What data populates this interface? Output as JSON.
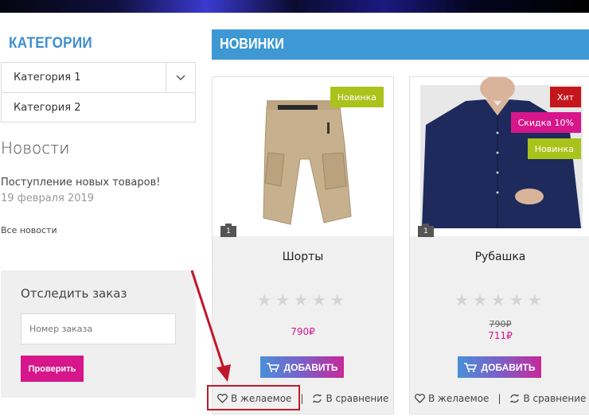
{
  "sidebar": {
    "categories_title": "КАТЕГОРИИ",
    "categories": [
      {
        "label": "Категория 1"
      },
      {
        "label": "Категория 2"
      }
    ],
    "news": {
      "title": "Новости",
      "item_title": "Поступление новых товаров!",
      "item_date": "19 февраля 2019",
      "all_link": "Все новости"
    },
    "track": {
      "title": "Отследить заказ",
      "input_placeholder": "Номер заказа",
      "button_label": "Проверить"
    }
  },
  "main": {
    "section_title": "НОВИНКИ",
    "products": [
      {
        "name": "Шорты",
        "badges": [
          {
            "label": "Новинка",
            "color": "#a9c31b"
          }
        ],
        "image_count": "1",
        "old_price": "",
        "price": "790₽",
        "add_label": "ДОБАВИТЬ",
        "wishlist_label": "В желаемое",
        "compare_label": "В сравнение"
      },
      {
        "name": "Рубашка",
        "badges": [
          {
            "label": "Хит",
            "color": "#c4161c"
          },
          {
            "label": "Скидка 10%",
            "color": "#d6168a"
          },
          {
            "label": "Новинка",
            "color": "#a9c31b"
          }
        ],
        "image_count": "1",
        "old_price": "790₽",
        "price": "711₽",
        "add_label": "ДОБАВИТЬ",
        "wishlist_label": "В желаемое",
        "compare_label": "В сравнение"
      }
    ]
  },
  "colors": {
    "accent_blue": "#3d98d3",
    "accent_pink": "#d6168a",
    "highlight_red": "#c0182b"
  }
}
